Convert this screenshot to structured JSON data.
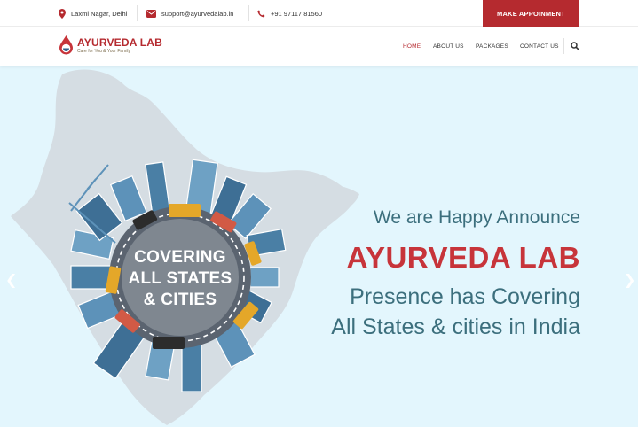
{
  "topbar": {
    "address": "Laxmi Nagar, Delhi",
    "email": "support@ayurvedalab.in",
    "phone": "+91 97117 81560",
    "cta": "MAKE APPOINMENT",
    "icons": [
      "location-pin-icon",
      "envelope-icon",
      "phone-icon"
    ]
  },
  "brand": {
    "name": "AYURVEDA LAB",
    "tagline": "Care for You & Your Family"
  },
  "nav": {
    "items": [
      "HOME",
      "ABOUT US",
      "PACKAGES",
      "CONTACT US"
    ],
    "active": "HOME",
    "search_icon": "search-icon"
  },
  "hero": {
    "circle_lines": [
      "COVERING",
      "ALL STATES",
      "& CITIES"
    ],
    "line1": "We are Happy Announce",
    "line2": "AYURVEDA LAB",
    "line3": "Presence has Covering",
    "line4": "All States & cities in India"
  },
  "colors": {
    "accent": "#b52a2f",
    "hero_bg": "#e3f6fd",
    "hero_text": "#3c6f7d",
    "map": "#d5dde3"
  }
}
